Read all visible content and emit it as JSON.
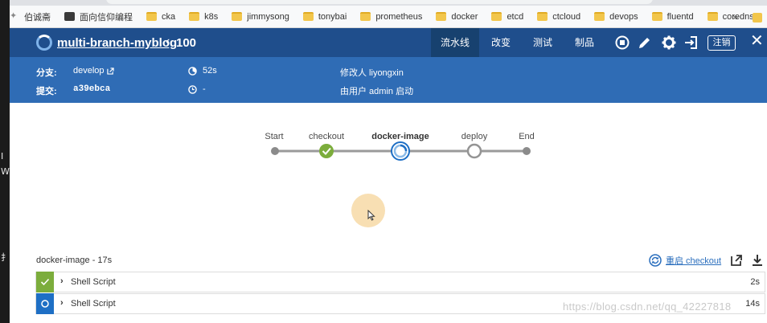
{
  "bookmarks": [
    {
      "label": "伯诚斋",
      "icon": "star"
    },
    {
      "label": "面向信仰编程",
      "icon": "dark"
    },
    {
      "label": "cka",
      "icon": "folder"
    },
    {
      "label": "k8s",
      "icon": "folder"
    },
    {
      "label": "jimmysong",
      "icon": "folder"
    },
    {
      "label": "tonybai",
      "icon": "folder"
    },
    {
      "label": "prometheus",
      "icon": "folder"
    },
    {
      "label": "docker",
      "icon": "folder"
    },
    {
      "label": "etcd",
      "icon": "folder"
    },
    {
      "label": "ctcloud",
      "icon": "folder"
    },
    {
      "label": "devops",
      "icon": "folder"
    },
    {
      "label": "fluentd",
      "icon": "folder"
    },
    {
      "label": "coredns",
      "icon": "folder"
    }
  ],
  "bookmarks_more": "»",
  "header": {
    "job_name": "multi-branch-myblog",
    "run_number": "100",
    "tabs": [
      "流水线",
      "改变",
      "测试",
      "制品"
    ],
    "active_tab": "流水线",
    "logout_label": "注销"
  },
  "summary": {
    "branch_label": "分支:",
    "branch_value": "develop",
    "commit_label": "提交:",
    "commit_value": "a39ebca",
    "duration_value": "52s",
    "time_value": "-",
    "changed_by": "修改人 liyongxin",
    "started_by": "由用户 admin 启动"
  },
  "pipeline": {
    "stages": [
      {
        "name": "Start",
        "status": "start"
      },
      {
        "name": "checkout",
        "status": "success"
      },
      {
        "name": "docker-image",
        "status": "running"
      },
      {
        "name": "deploy",
        "status": "queued"
      },
      {
        "name": "End",
        "status": "end"
      }
    ]
  },
  "steps": {
    "title": "docker-image - 17s",
    "restart_label": "重启 checkout",
    "rows": [
      {
        "name": "Shell Script",
        "duration": "2s",
        "status": "success"
      },
      {
        "name": "Shell Script",
        "duration": "14s",
        "status": "running"
      }
    ]
  },
  "watermark": "https://blog.csdn.net/qq_42227818",
  "colors": {
    "header_bg": "#1f4e8c",
    "summary_bg": "#2f6cb5",
    "success": "#7cad3c",
    "running": "#1e6fc5",
    "queued": "#999999"
  }
}
